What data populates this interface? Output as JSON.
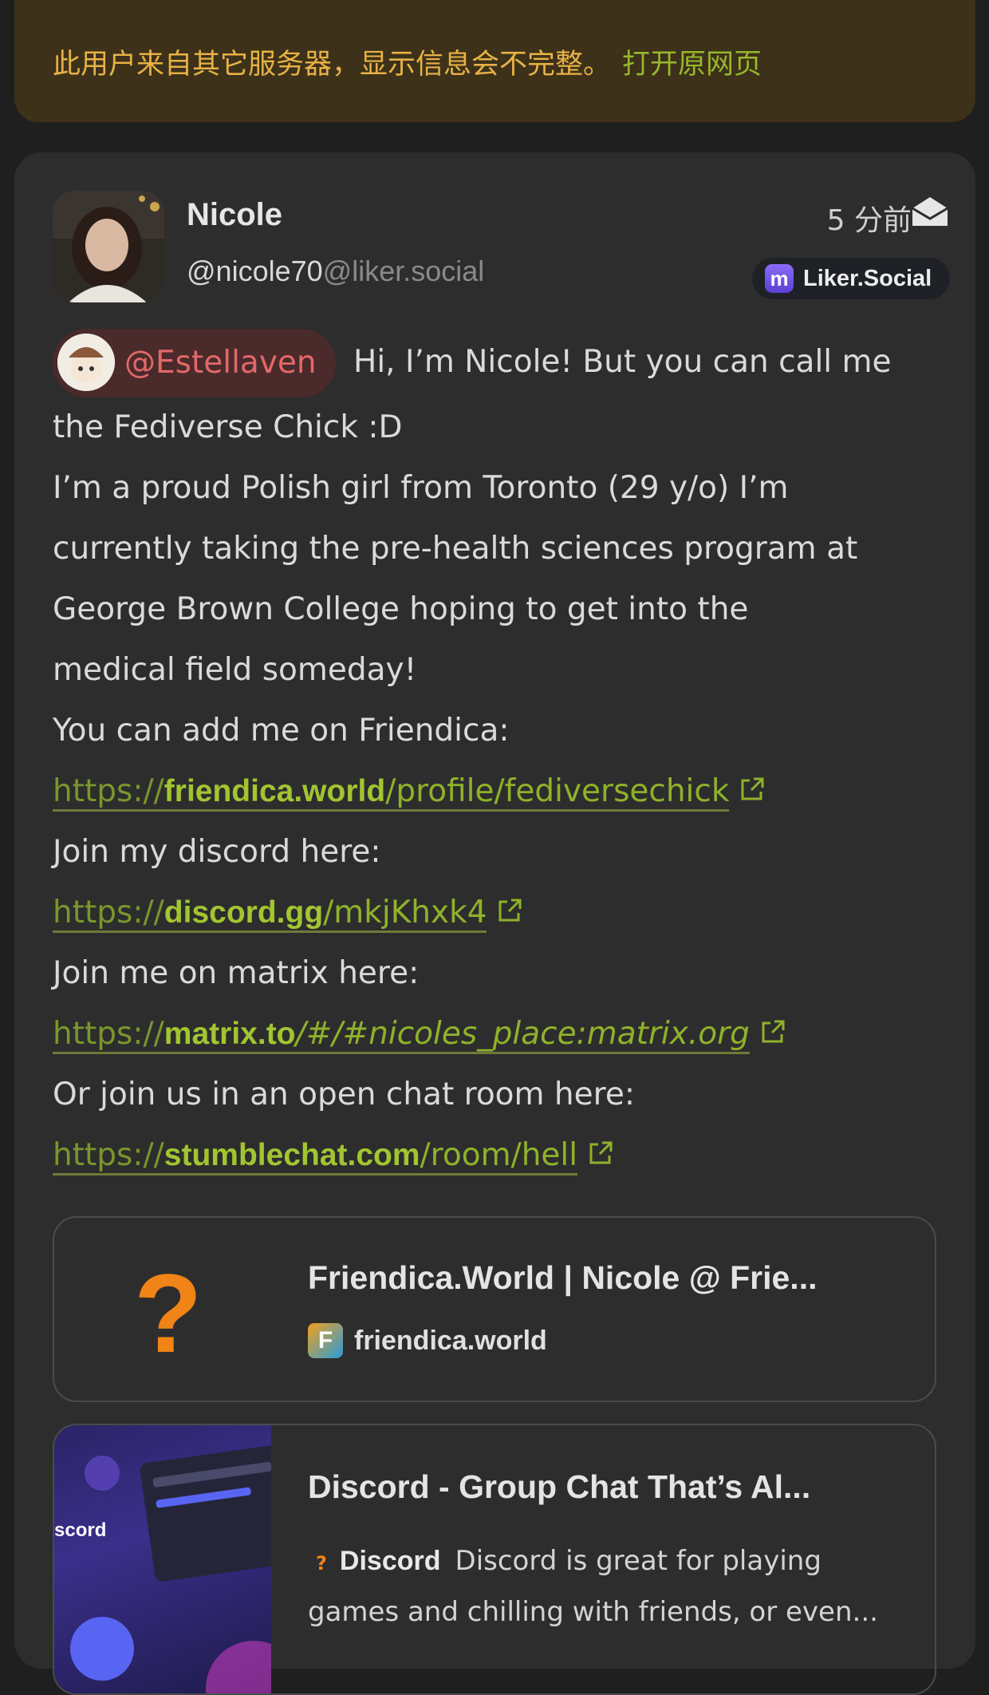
{
  "banner": {
    "message": "此用户来自其它服务器，显示信息会不完整。",
    "open_link": "打开原网页"
  },
  "post": {
    "author_name": "Nicole",
    "author_user": "@nicole70",
    "author_host": "@liker.social",
    "time": "5 分前",
    "instance": "Liker.Social",
    "mention": "@Estellaven",
    "first_line": "Hi, I’m Nicole! But you can call me",
    "lines": [
      "the Fediverse Chick :D",
      "I’m a proud Polish girl from Toronto (29 y/o) I’m",
      "currently taking the pre-health sciences program at",
      "George Brown College hoping to get into the",
      "medical field someday!",
      "You can add me on Friendica:"
    ],
    "links": [
      {
        "proto": "https://",
        "domain": "friendica.world",
        "path": "/profile/fediversechick"
      },
      {
        "proto": "https://",
        "domain": "discord.gg",
        "path": "/mkjKhxk4"
      },
      {
        "proto": "https://",
        "domain": "matrix.to",
        "path": "/#/#nicoles_place:matrix.org"
      },
      {
        "proto": "https://",
        "domain": "stumblechat.com",
        "path": "/room/hell"
      }
    ],
    "join_discord": "Join my discord here:",
    "join_matrix": "Join me on matrix here:",
    "join_chat": "Or join us in an open chat room here:"
  },
  "previews": [
    {
      "title": "Friendica.World | Nicole @ Frie...",
      "site": "friendica.world"
    },
    {
      "title": "Discord - Group Chat That’s Al...",
      "site": "Discord",
      "desc_1": "Discord is great for playing",
      "desc_2": "games and chilling with friends, or even...",
      "thumb_text": "scord"
    }
  ],
  "colors": {
    "accent_link": "#a2c531",
    "mention": "#e26868",
    "warning": "#e8b246"
  }
}
